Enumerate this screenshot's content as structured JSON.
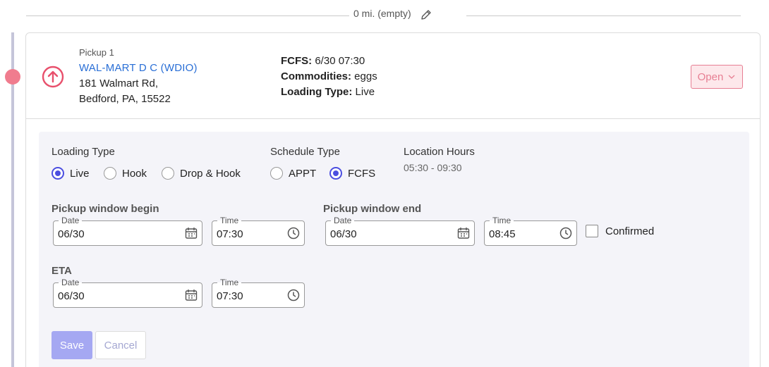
{
  "distance": {
    "text": "0 mi. (empty)",
    "edit_icon": "pencil-icon"
  },
  "stop": {
    "label": "Pickup 1",
    "facility": "WAL-MART D C (WDIO)",
    "address_line1": "181 Walmart Rd,",
    "address_line2": "Bedford, PA, 15522",
    "info": {
      "fcfs_key": "FCFS:",
      "fcfs_value": " 6/30 07:30",
      "commodities_key": "Commodities:",
      "commodities_value": " eggs",
      "loading_type_key": "Loading Type:",
      "loading_type_value": " Live"
    },
    "status": "Open",
    "icon": "arrow-up-circle-icon",
    "accent_color": "#e8506c"
  },
  "form": {
    "loading_type": {
      "label": "Loading Type",
      "options": [
        "Live",
        "Hook",
        "Drop & Hook"
      ],
      "selected": "Live"
    },
    "schedule_type": {
      "label": "Schedule Type",
      "options": [
        "APPT",
        "FCFS"
      ],
      "selected": "FCFS"
    },
    "location_hours": {
      "label": "Location Hours",
      "value": "05:30 - 09:30"
    },
    "pickup_begin": {
      "label": "Pickup window begin",
      "date_label": "Date",
      "date": "06/30",
      "time_label": "Time",
      "time": "07:30"
    },
    "pickup_end": {
      "label": "Pickup window end",
      "date_label": "Date",
      "date": "06/30",
      "time_label": "Time",
      "time": "08:45"
    },
    "confirmed": {
      "label": "Confirmed",
      "checked": false
    },
    "eta": {
      "label": "ETA",
      "date_label": "Date",
      "date": "06/30",
      "time_label": "Time",
      "time": "07:30"
    },
    "save_label": "Save",
    "cancel_label": "Cancel",
    "primary_color": "#4b4ee0"
  }
}
